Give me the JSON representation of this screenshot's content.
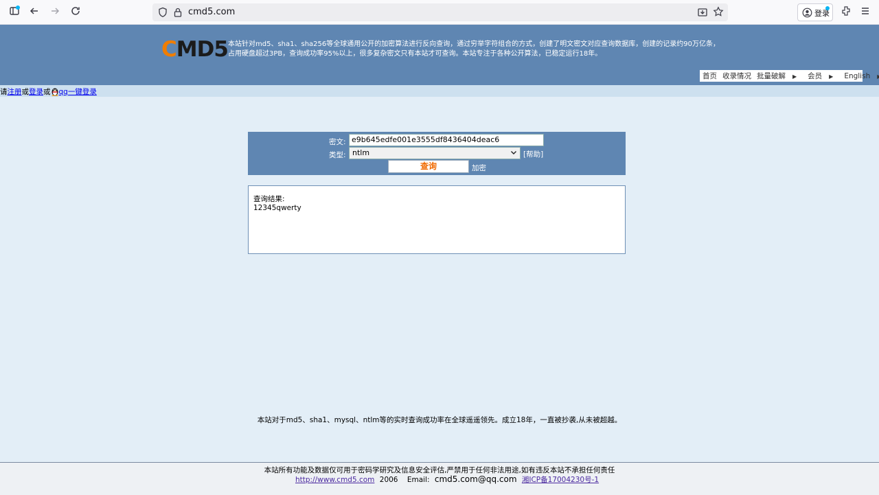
{
  "browser": {
    "url": "cmd5.com",
    "login_label": "登录",
    "colors": {
      "toolbar": "#f9f9fb",
      "urlbar": "#ededf0",
      "notify_dot": "#0ab5f4"
    }
  },
  "header": {
    "logo_c": "C",
    "logo_rest": "MD5",
    "intro_line1": "本站针对md5、sha1、sha256等全球通用公开的加密算法进行反向查询，通过穷举字符组合的方式，创建了明文密文对应查询数据库，创建的记录约90万亿条，",
    "intro_line2": "占用硬盘超过3PB，查询成功率95%以上，很多复杂密文只有本站才可查询。本站专注于各种公开算法，已稳定运行18年。",
    "nav": [
      {
        "label": "首页"
      },
      {
        "label": "收录情况"
      },
      {
        "label": "批量破解",
        "arrow": "▶"
      },
      {
        "label": "会员",
        "arrow": "▶"
      },
      {
        "label": "English",
        "arrow": "▶"
      }
    ],
    "colors": {
      "header_bg": "#5f86b2",
      "logo_accent": "#f07d00"
    }
  },
  "loginbar": {
    "prefix": "请",
    "register": "注册",
    "or1": "或",
    "login": "登录",
    "or2": "或",
    "qq_login": "qq一键登录"
  },
  "query": {
    "cipher_label": "密文:",
    "cipher_value": "e9b645edfe001e3555df8436404deac6",
    "type_label": "类型:",
    "type_selected": "ntlm",
    "help_link": "[帮助]",
    "submit": "查询",
    "encrypt_link": "加密"
  },
  "result": {
    "label": "查询结果:",
    "value": "12345qwerty"
  },
  "claim": "本站对于md5、sha1、mysql、ntlm等的实时查询成功率在全球遥遥领先。成立18年，一直被抄袭,从未被超越。",
  "footer": {
    "note": "本站所有功能及数据仅可用于密码学研究及信息安全评估,严禁用于任何非法用途,如有违反本站不承担任何责任",
    "site_link": "http://www.cmd5.com",
    "year": "2006",
    "email_label": "Email:",
    "email": "cmd5.com@qq.com",
    "icp": "湘ICP备17004230号-1"
  }
}
